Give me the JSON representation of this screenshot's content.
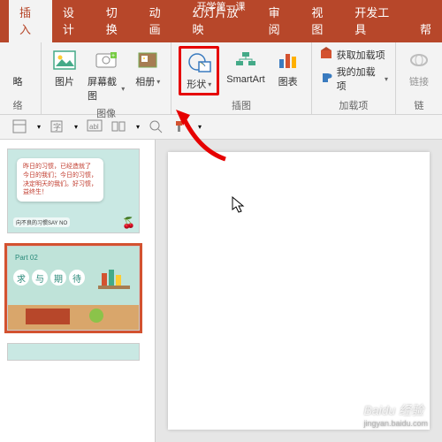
{
  "titlebar": "开学第一课",
  "tabs": [
    "插入",
    "设计",
    "切换",
    "动画",
    "幻灯片放映",
    "审阅",
    "视图",
    "开发工具",
    "帮"
  ],
  "activeTab": 0,
  "ribbon": {
    "group0": {
      "label": "络",
      "items": [
        {
          "label": "略"
        }
      ]
    },
    "group1": {
      "label": "图像",
      "items": [
        {
          "label": "图片",
          "icon": "picture"
        },
        {
          "label": "屏幕截图",
          "icon": "screenshot",
          "dropdown": true
        },
        {
          "label": "相册",
          "icon": "album",
          "dropdown": true
        }
      ]
    },
    "group2": {
      "label": "插图",
      "items": [
        {
          "label": "形状",
          "icon": "shapes",
          "dropdown": true,
          "highlight": true
        },
        {
          "label": "SmartArt",
          "icon": "smartart"
        },
        {
          "label": "图表",
          "icon": "chart"
        }
      ]
    },
    "group3": {
      "label": "加载项",
      "items": [
        {
          "label": "获取加载项",
          "icon": "store"
        },
        {
          "label": "我的加载项",
          "icon": "myaddins",
          "dropdown": true
        }
      ]
    },
    "group4": {
      "label": "链",
      "items": [
        {
          "label": "链接",
          "icon": "link"
        }
      ]
    }
  },
  "thumbs": {
    "slide1": {
      "bg": "#c9e8e3",
      "lines": [
        "昨日的习惯，已经造就了",
        "今日的我们；今日的习惯，",
        "决定明天的我们。好习惯，",
        "益终生！"
      ],
      "bottom": "向不良的习惯SAY NO"
    },
    "slide2": {
      "bg": "#bfe3d9",
      "part": "Part 02",
      "chars": [
        "求",
        "与",
        "期",
        "待"
      ]
    }
  },
  "watermark": {
    "main": "Baidu 经验",
    "sub": "jingyan.baidu.com"
  }
}
